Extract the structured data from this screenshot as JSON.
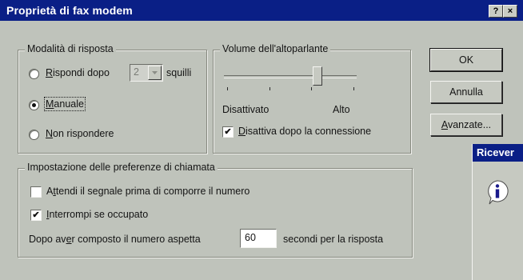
{
  "window": {
    "title": "Proprietà di fax modem",
    "help_glyph": "?",
    "close_glyph": "×"
  },
  "answer_mode": {
    "legend": "Modalità di risposta",
    "options": [
      {
        "label_first": "R",
        "label_rest": "ispondi dopo",
        "checked": false
      },
      {
        "label_first": "M",
        "label_rest": "anuale",
        "checked": true
      },
      {
        "label_first": "N",
        "label_rest": "on rispondere",
        "checked": false
      }
    ],
    "rings_value": "2",
    "rings_suffix": "squilli"
  },
  "speaker": {
    "legend": "Volume dell'altoparlante",
    "min_label": "Disattivato",
    "max_label": "Alto",
    "level_fraction": 0.7,
    "tick_count": 4,
    "disable_after_connect": {
      "label_first": "D",
      "label_rest": "isattiva dopo la connessione",
      "checked": true
    }
  },
  "call_prefs": {
    "legend": "Impostazione delle preferenze di chiamata",
    "wait_dial_tone": {
      "label_pre": "A",
      "label_u": "t",
      "label_rest": "tendi il segnale prima di comporre il numero",
      "checked": false
    },
    "hang_up_busy": {
      "label_first": "I",
      "label_rest": "nterrompi se occupato",
      "checked": true
    },
    "wait_pre": "Dopo av",
    "wait_u": "e",
    "wait_rest": "r composto il numero aspetta",
    "wait_value": "60",
    "wait_suffix": "secondi per la risposta"
  },
  "buttons": {
    "ok": "OK",
    "cancel": "Annulla",
    "advanced_first": "A",
    "advanced_rest": "vanzate..."
  },
  "side_panel": {
    "title": "Ricever",
    "icon": "info-icon"
  },
  "colors": {
    "face": "#bfc3bb",
    "title_bar": "#0a1f86",
    "side_panel_title": "#0a1f86"
  }
}
